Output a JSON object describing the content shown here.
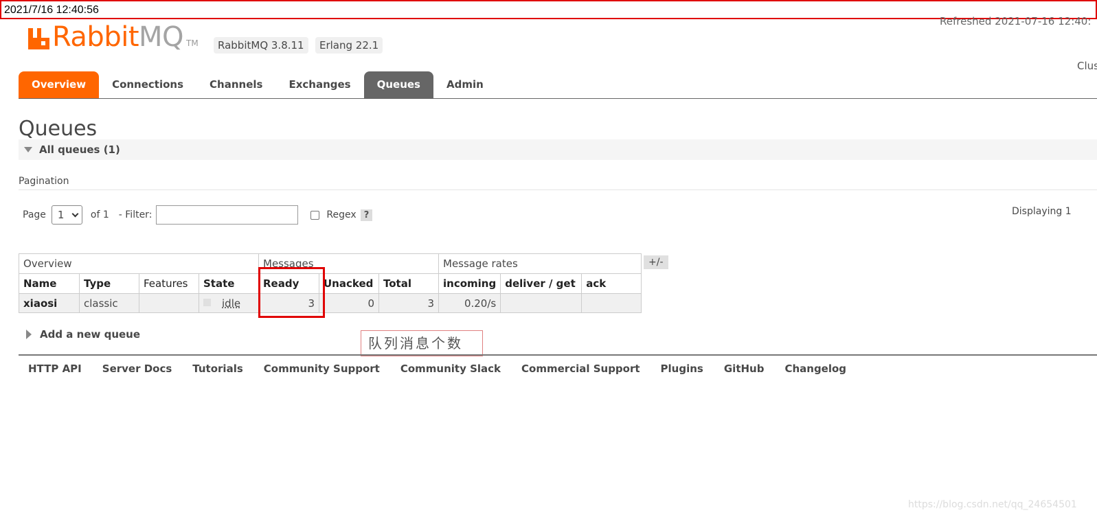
{
  "timestamp": "2021/7/16 12:40:56",
  "header": {
    "logo_rabbit": "Rabbit",
    "logo_mq": "MQ",
    "logo_tm": "TM",
    "version": "RabbitMQ 3.8.11",
    "erlang": "Erlang 22.1",
    "refreshed": "Refreshed 2021-07-16 12:40:",
    "cluster": "Clus"
  },
  "colors": {
    "brand": "#ff6600",
    "active_tab": "#666666",
    "highlight": "#e00000"
  },
  "tabs": [
    {
      "label": "Overview"
    },
    {
      "label": "Connections"
    },
    {
      "label": "Channels"
    },
    {
      "label": "Exchanges"
    },
    {
      "label": "Queues"
    },
    {
      "label": "Admin"
    }
  ],
  "page": {
    "title": "Queues",
    "section": "All queues (1)"
  },
  "pagination": {
    "label": "Pagination",
    "page_label": "Page",
    "page_value": "1",
    "of_label": "of 1",
    "filter_label": "- Filter:",
    "regex_label": "Regex",
    "help": "?",
    "displaying": "Displaying 1"
  },
  "table": {
    "groups": {
      "overview": "Overview",
      "messages": "Messages",
      "rates": "Message rates"
    },
    "columns": [
      "Name",
      "Type",
      "Features",
      "State",
      "Ready",
      "Unacked",
      "Total",
      "incoming",
      "deliver / get",
      "ack"
    ],
    "rows": [
      {
        "name": "xiaosi",
        "type": "classic",
        "features": "",
        "state": "idle",
        "ready": "3",
        "unacked": "0",
        "total": "3",
        "incoming": "0.20/s",
        "deliver": "",
        "ack": ""
      }
    ],
    "toggle": "+/-"
  },
  "annotation": "队列消息个数",
  "add_queue": "Add a new queue",
  "footer": [
    "HTTP API",
    "Server Docs",
    "Tutorials",
    "Community Support",
    "Community Slack",
    "Commercial Support",
    "Plugins",
    "GitHub",
    "Changelog"
  ],
  "watermark": "https://blog.csdn.net/qq_24654501"
}
